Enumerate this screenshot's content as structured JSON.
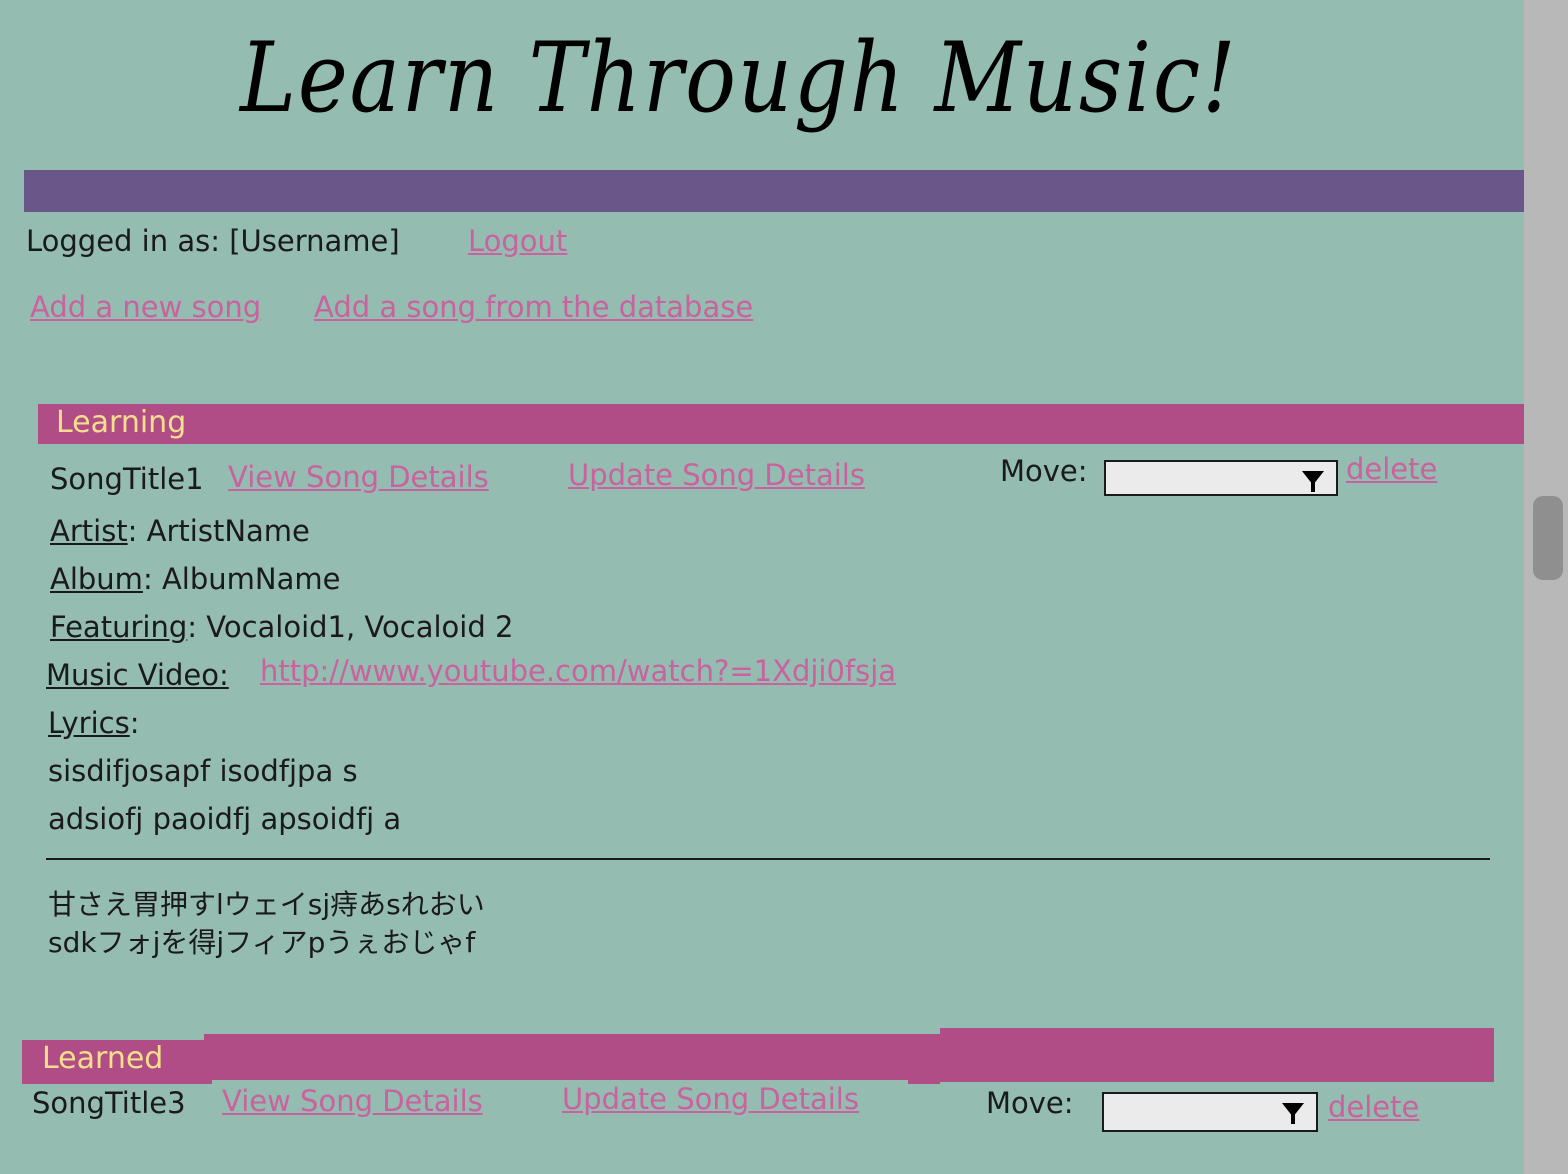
{
  "header": {
    "title": "Learn Through Music!"
  },
  "session": {
    "logged_in_label": "Logged in as: [Username]",
    "logout": "Logout"
  },
  "actions": {
    "add_new": "Add a new song",
    "add_from_db": "Add a song from the database"
  },
  "sections": {
    "learning": {
      "label": "Learning",
      "song": {
        "title": "SongTitle1",
        "view": "View Song Details",
        "update": "Update Song Details",
        "move_label": "Move:",
        "move_value": "",
        "delete": "delete",
        "artist_label": "Artist",
        "artist_sep": ":",
        "artist": "ArtistName",
        "album_label": "Album",
        "album_sep": ":",
        "album": "AlbumName",
        "featuring_label": "Featuring",
        "featuring_sep": ":",
        "featuring": "Vocaloid1, Vocaloid 2",
        "video_label": "Music Video:",
        "video_url": "http://www.youtube.com/watch?=1Xdji0fsja",
        "lyrics_label": "Lyrics",
        "lyrics_sep": ":",
        "lyrics_lines": [
          "sisdifjosapf isodfjpa s",
          "adsiofj paoidfj apsoidfj a"
        ],
        "translation_lines": [
          "甘さえ胃押すlウェイsj痔あsれおい",
          "sdkフォjを得jフィアpうぇおじゃf"
        ]
      }
    },
    "learned": {
      "label": "Learned",
      "song": {
        "title": "SongTitle3",
        "view": "View Song Details",
        "update": "Update Song Details",
        "move_label": "Move:",
        "move_value": "",
        "delete": "delete"
      }
    }
  },
  "colors": {
    "background": "#94bcb0",
    "header_bar": "#6b5689",
    "section_bar": "#b04d87",
    "section_text": "#f5df8c",
    "link": "#c9629e"
  }
}
